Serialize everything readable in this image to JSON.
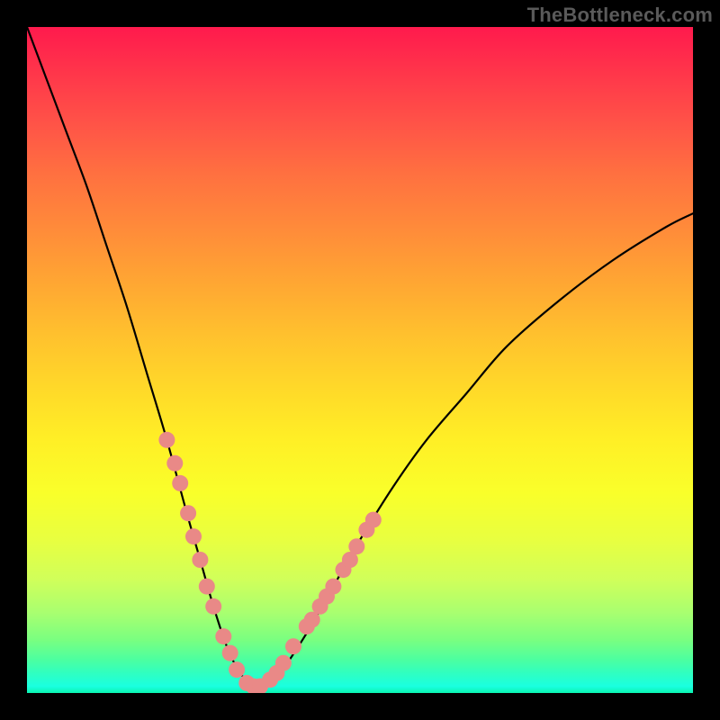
{
  "watermark": "TheBottleneck.com",
  "chart_data": {
    "type": "line",
    "title": "",
    "xlabel": "",
    "ylabel": "",
    "xlim": [
      0,
      100
    ],
    "ylim": [
      0,
      100
    ],
    "series": [
      {
        "name": "bottleneck-curve",
        "x": [
          0,
          3,
          6,
          9,
          12,
          15,
          18,
          21,
          24,
          26,
          28,
          30,
          32,
          34,
          36,
          38,
          42,
          46,
          50,
          55,
          60,
          66,
          72,
          80,
          88,
          96,
          100
        ],
        "y": [
          100,
          92,
          84,
          76,
          67,
          58,
          48,
          38,
          27,
          20,
          13,
          7,
          3,
          1,
          1,
          3,
          9,
          16,
          23,
          31,
          38,
          45,
          52,
          59,
          65,
          70,
          72
        ]
      }
    ],
    "markers": {
      "name": "sample-dots",
      "color": "#e98987",
      "radius_px": 9,
      "points_xy": [
        [
          21.0,
          38.0
        ],
        [
          22.2,
          34.5
        ],
        [
          23.0,
          31.5
        ],
        [
          24.2,
          27.0
        ],
        [
          25.0,
          23.5
        ],
        [
          26.0,
          20.0
        ],
        [
          27.0,
          16.0
        ],
        [
          28.0,
          13.0
        ],
        [
          29.5,
          8.5
        ],
        [
          30.5,
          6.0
        ],
        [
          31.5,
          3.5
        ],
        [
          33.0,
          1.5
        ],
        [
          34.0,
          1.0
        ],
        [
          35.0,
          1.0
        ],
        [
          36.5,
          2.0
        ],
        [
          37.5,
          3.0
        ],
        [
          38.5,
          4.5
        ],
        [
          40.0,
          7.0
        ],
        [
          42.0,
          10.0
        ],
        [
          42.8,
          11.0
        ],
        [
          44.0,
          13.0
        ],
        [
          45.0,
          14.5
        ],
        [
          46.0,
          16.0
        ],
        [
          47.5,
          18.5
        ],
        [
          48.5,
          20.0
        ],
        [
          49.5,
          22.0
        ],
        [
          51.0,
          24.5
        ],
        [
          52.0,
          26.0
        ]
      ]
    },
    "gradient_meaning": "vertical gradient from red (higher bottleneck) at top to green (optimal) at bottom"
  }
}
